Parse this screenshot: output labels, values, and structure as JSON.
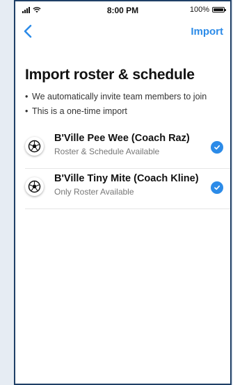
{
  "status_bar": {
    "time": "8:00 PM",
    "battery_percent": "100%",
    "icons": [
      "signal-icon",
      "wifi-icon",
      "battery-icon"
    ]
  },
  "nav": {
    "back_icon": "chevron-left-icon",
    "import_label": "Import"
  },
  "page": {
    "title": "Import roster & schedule",
    "bullets": [
      "We automatically invite team members to join",
      "This is a one-time import"
    ]
  },
  "teams": [
    {
      "name": "B'Ville Pee Wee (Coach Raz)",
      "status": "Roster & Schedule Available",
      "selected": true,
      "icon": "soccer-ball-icon"
    },
    {
      "name": "B'Ville Tiny Mite (Coach Kline)",
      "status": "Only Roster Available",
      "selected": true,
      "icon": "soccer-ball-icon"
    }
  ],
  "colors": {
    "accent": "#2c8be8",
    "frame_border": "#1f3f66",
    "text": "#111111",
    "secondary_text": "#777777"
  }
}
